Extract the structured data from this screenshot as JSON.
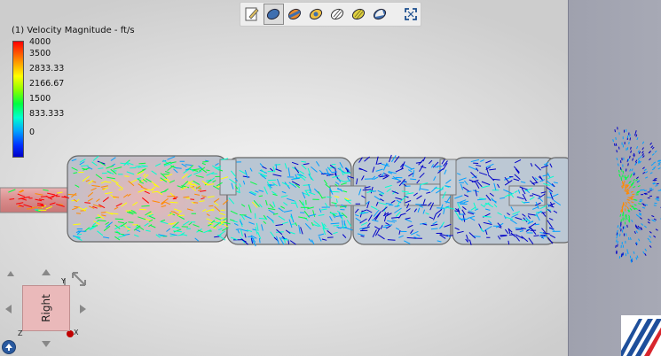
{
  "toolbar": {
    "buttons": [
      {
        "icon": "edit-icon",
        "active": false
      },
      {
        "icon": "shaded-display-icon",
        "active": true
      },
      {
        "icon": "shaded-with-edges-icon",
        "active": false
      },
      {
        "icon": "section-view-icon",
        "active": false
      },
      {
        "icon": "transparent-view-icon",
        "active": false
      },
      {
        "icon": "material-view-icon",
        "active": false
      },
      {
        "icon": "outline-view-icon",
        "active": false
      },
      {
        "icon": "fit-to-screen-icon",
        "active": false
      }
    ]
  },
  "legend": {
    "title": "(1) Velocity Magnitude - ft/s",
    "ticks": [
      "4000",
      "3500",
      "2833.33",
      "2166.67",
      "1500",
      "833.333",
      "0"
    ],
    "colors": [
      "#ff0000",
      "#ff8a00",
      "#ffff00",
      "#00ff40",
      "#00ffd0",
      "#00a0ff",
      "#0000c8"
    ]
  },
  "navcube": {
    "face_label": "Right",
    "axis_y": "Y",
    "axis_z": "Z",
    "axis_x": "X"
  }
}
